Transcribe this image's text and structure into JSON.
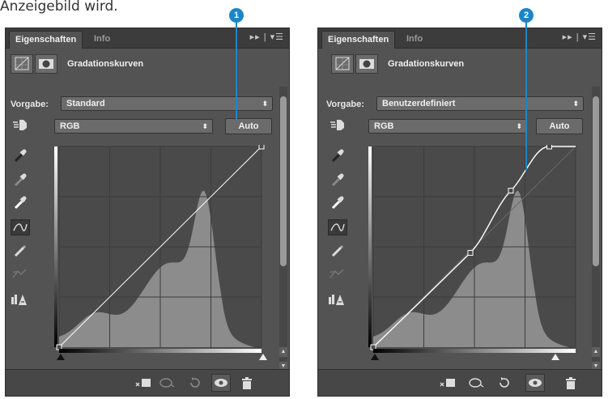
{
  "caption": "Anzeigebild wird.",
  "callouts": {
    "left": "1",
    "right": "2"
  },
  "panels": [
    {
      "tabs": [
        "Eigenschaften",
        "Info"
      ],
      "menu_glyph": "▸▸ | ▾☰",
      "title": "Gradationskurven",
      "vorgabe_label": "Vorgabe:",
      "vorgabe_value": "Standard",
      "channel_value": "RGB",
      "auto_label": "Auto",
      "curve": "standard"
    },
    {
      "tabs": [
        "Eigenschaften",
        "Info"
      ],
      "menu_glyph": "▸▸ | ▾☰",
      "title": "Gradationskurven",
      "vorgabe_label": "Vorgabe:",
      "vorgabe_value": "Benutzerdefiniert",
      "channel_value": "RGB",
      "auto_label": "Auto",
      "curve": "custom"
    }
  ],
  "icons": {
    "tools": [
      "adjust-hand-icon",
      "black-point-eyedropper-icon",
      "gray-point-eyedropper-icon",
      "white-point-eyedropper-icon",
      "curve-points-icon",
      "pencil-icon",
      "smooth-icon",
      "clipping-warning-icon"
    ],
    "footer": [
      "clip-to-layer-icon",
      "view-previous-icon",
      "reset-icon",
      "visibility-eye-icon",
      "trash-icon"
    ]
  },
  "accent_color": "#1a86c8"
}
